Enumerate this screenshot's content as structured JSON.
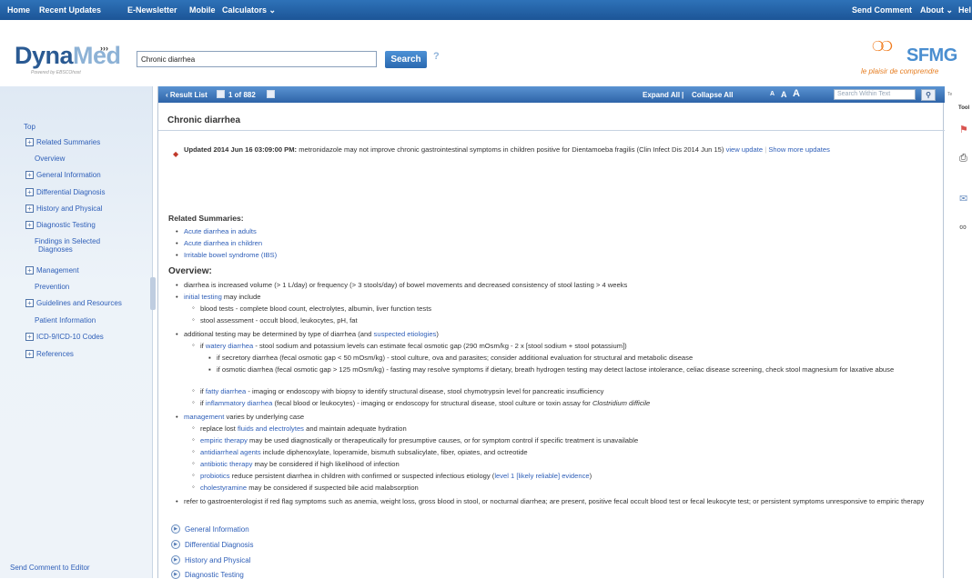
{
  "topnav": {
    "home": "Home",
    "recent_updates": "Recent Updates",
    "enewsletter": "E-Newsletter",
    "mobile": "Mobile",
    "calculators": "Calculators",
    "send_comment": "Send Comment",
    "about": "About",
    "help": "Hel"
  },
  "header": {
    "logo_dyna": "Dyna",
    "logo_med": "Med",
    "logo_sub": "Powered by EBSCOhost",
    "search_value": "Chronic diarrhea",
    "search_button": "Search",
    "help_mark": "?",
    "partner_logo": "SFMG",
    "partner_tagline": "le plaisir de comprendre"
  },
  "left_nav": {
    "top": "Top",
    "items": [
      {
        "label": "Related Summaries",
        "plus": true
      },
      {
        "label": "Overview",
        "plus": false
      },
      {
        "label": "General Information",
        "plus": true
      },
      {
        "label": "Differential Diagnosis",
        "plus": true
      },
      {
        "label": "History and Physical",
        "plus": true
      },
      {
        "label": "Diagnostic Testing",
        "plus": true
      },
      {
        "label": "Findings in Selected",
        "label2": "Diagnoses",
        "plus": false
      },
      {
        "label": "Management",
        "plus": true
      },
      {
        "label": "Prevention",
        "plus": false
      },
      {
        "label": "Guidelines and Resources",
        "plus": true
      },
      {
        "label": "Patient Information",
        "plus": false
      },
      {
        "label": "ICD-9/ICD-10 Codes",
        "plus": true
      },
      {
        "label": "References",
        "plus": true
      }
    ],
    "send_comment": "Send Comment to Editor"
  },
  "result_bar": {
    "result_list": "‹ Result List",
    "position": "1 of 882",
    "expand_all": "Expand All",
    "collapse_all": "Collapse All",
    "font_small": "A",
    "font_medium": "A",
    "font_large": "A",
    "search_within_placeholder": "Search Within Text"
  },
  "doc": {
    "title": "Chronic diarrhea",
    "update_bold": "Updated 2014 Jun 16 03:09:00 PM:",
    "update_text": " metronidazole may not improve chronic gastrointestinal symptoms in children positive for Dientamoeba fragilis (Clin Infect Dis 2014 Jun 15)",
    "view_update": "view update",
    "show_more": "Show more updates",
    "related_heading": "Related Summaries:",
    "related": [
      "Acute diarrhea in adults",
      "Acute diarrhea in children",
      "Irritable bowel syndrome (IBS)"
    ],
    "overview_heading": "Overview:",
    "ov1": "diarrhea is increased volume (> 1 L/day) or frequency (> 3 stools/day) of bowel movements and decreased consistency of stool lasting > 4 weeks",
    "ov2_link": "initial testing",
    "ov2_text": " may include",
    "ov2_a": "blood tests - complete blood count, electrolytes, albumin, liver function tests",
    "ov2_b": "stool assessment - occult blood, leukocytes, pH, fat",
    "ov3_text": "additional testing may be determined by type of diarrhea (and ",
    "ov3_link": "suspected etiologies",
    "ov3_end": ")",
    "wd_pre": "if ",
    "wd_link": "watery diarrhea",
    "wd_text": " - stool sodium and potassium levels can estimate fecal osmotic gap (290 mOsm/kg - 2 x [stool sodium + stool potassium])",
    "wd_a": "if secretory diarrhea (fecal osmotic gap < 50 mOsm/kg) - stool culture, ova and parasites; consider additional evaluation for structural and metabolic disease",
    "wd_b": "if osmotic diarrhea (fecal osmotic gap > 125 mOsm/kg) - fasting may resolve symptoms if dietary, breath hydrogen testing may detect lactose intolerance, celiac disease screening, check stool magnesium for laxative abuse",
    "fd_pre": "if ",
    "fd_link": "fatty diarrhea",
    "fd_text": " - imaging or endoscopy with biopsy to identify structural disease, stool chymotrypsin level for pancreatic insufficiency",
    "id_pre": "if ",
    "id_link": "inflammatory diarrhea",
    "id_text": " (fecal blood or leukocytes) - imaging or endoscopy for structural disease, stool culture or toxin assay for ",
    "id_italic": "Clostridium difficile",
    "mg_link": "management",
    "mg_text": " varies by underlying case",
    "mg_a_pre": "replace lost ",
    "mg_a_link": "fluids and electrolytes",
    "mg_a_text": " and maintain adequate hydration",
    "mg_b_link": "empiric therapy",
    "mg_b_text": " may be used diagnostically or therapeutically for presumptive causes, or for symptom control if specific treatment is unavailable",
    "mg_c_link": "antidiarrheal agents",
    "mg_c_text": " include diphenoxylate, loperamide, bismuth subsalicylate, fiber, opiates, and octreotide",
    "mg_d_link": "antibiotic therapy",
    "mg_d_text": " may be considered if high likelihood of infection",
    "mg_e_link": "probiotics",
    "mg_e_text": " reduce persistent diarrhea in children with confirmed or suspected infectious etiology (",
    "mg_e_link2": "level 1 [likely reliable] evidence",
    "mg_e_end": ")",
    "mg_f_link": "cholestyramine",
    "mg_f_text": " may be considered if suspected bile acid malabsorption",
    "ref": "refer to gastroenterologist if red flag symptoms such as anemia, weight loss, gross blood in stool, or nocturnal diarrhea; are present, positive fecal occult blood test or fecal leukocyte test; or persistent symptoms unresponsive to empiric therapy",
    "sections": [
      "General Information",
      "Differential Diagnosis",
      "History and Physical",
      "Diagnostic Testing"
    ]
  },
  "tools": {
    "label": "Tool",
    "side": "Te"
  }
}
